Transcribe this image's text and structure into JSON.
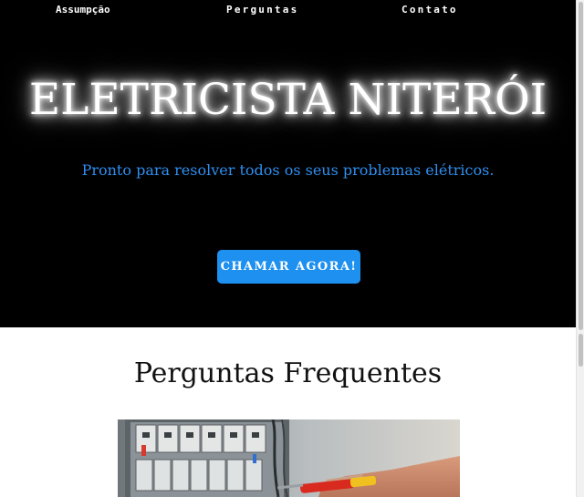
{
  "nav": {
    "items": [
      {
        "label": "Assumpção"
      },
      {
        "label": "Perguntas"
      },
      {
        "label": "Contato"
      }
    ]
  },
  "hero": {
    "title": "ELETRICISTA NITERÓI",
    "subtitle": "Pronto para resolver todos os seus problemas elétricos.",
    "cta_label": "CHAMAR AGORA!"
  },
  "faq": {
    "title": "Perguntas Frequentes"
  },
  "colors": {
    "hero_bg": "#000000",
    "accent_blue": "#1e90f0",
    "subtitle_blue": "#2e8ff0"
  }
}
